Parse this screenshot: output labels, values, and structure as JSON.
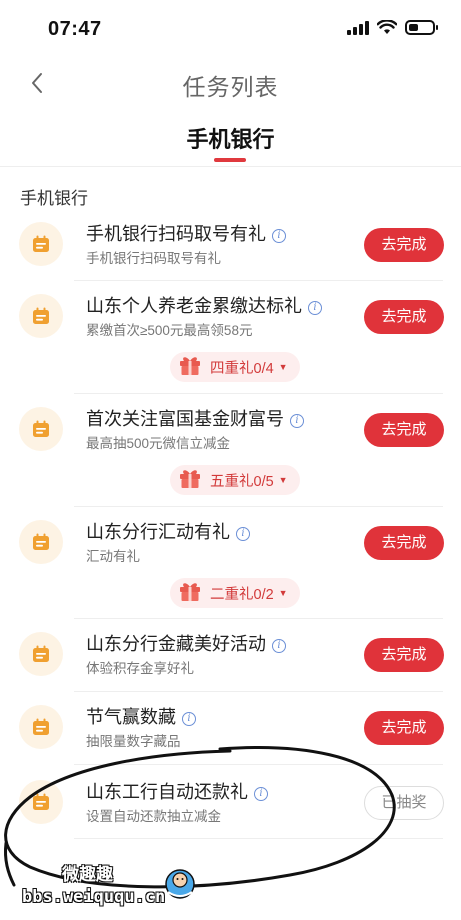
{
  "status_bar": {
    "time": "07:47"
  },
  "nav": {
    "title": "任务列表"
  },
  "tabs": {
    "active_label": "手机银行"
  },
  "section_title": "手机银行",
  "tasks": [
    {
      "title": "手机银行扫码取号有礼",
      "subtitle": "手机银行扫码取号有礼",
      "button": "去完成",
      "gift": null
    },
    {
      "title": "山东个人养老金累缴达标礼",
      "subtitle": "累缴首次≥500元最高领58元",
      "button": "去完成",
      "gift": "四重礼0/4"
    },
    {
      "title": "首次关注富国基金财富号",
      "subtitle": "最高抽500元微信立减金",
      "button": "去完成",
      "gift": "五重礼0/5"
    },
    {
      "title": "山东分行汇动有礼",
      "subtitle": "汇动有礼",
      "button": "去完成",
      "gift": "二重礼0/2"
    },
    {
      "title": "山东分行金藏美好活动",
      "subtitle": "体验积存金享好礼",
      "button": "去完成",
      "gift": null
    },
    {
      "title": "节气赢数藏",
      "subtitle": "抽限量数字藏品",
      "button": "去完成",
      "gift": null
    },
    {
      "title": "山东工行自动还款礼",
      "subtitle": "设置自动还款抽立减金",
      "button": "已抽奖",
      "gift": null
    }
  ],
  "icons": {
    "back": "chevron-left-icon",
    "task": "calendar-icon",
    "info": "info-icon",
    "gift": "gift-icon"
  },
  "colors": {
    "accent": "#e0333a",
    "icon_bg": "#fdf3e4",
    "icon_fg": "#f0a030",
    "gift_bg": "#fdeeee"
  },
  "watermark": {
    "line1": "微趣趣",
    "line2": "bbs.weiququ.cn"
  }
}
